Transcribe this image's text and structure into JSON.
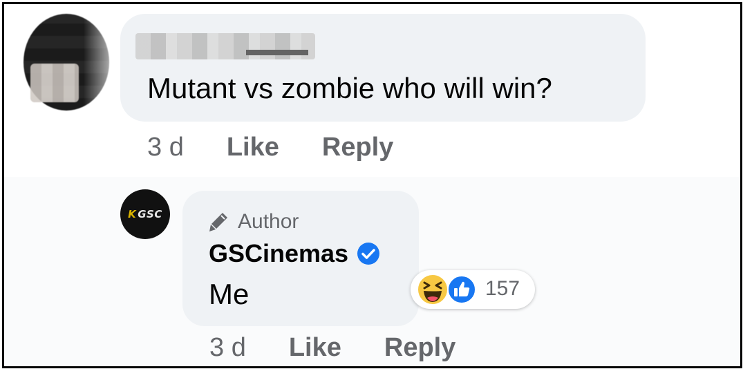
{
  "comment": {
    "author_name_redacted": true,
    "text": "Mutant vs zombie who will win?",
    "time": "3 d",
    "like_label": "Like",
    "reply_label": "Reply"
  },
  "reply": {
    "badge": "Author",
    "author_name": "GSCinemas",
    "avatar_logo_text": "GSC",
    "verified": true,
    "text": "Me",
    "reactions": {
      "types": [
        "haha",
        "like"
      ],
      "count": "157"
    },
    "time": "3 d",
    "like_label": "Like",
    "reply_label": "Reply"
  },
  "colors": {
    "bubble": "#eff2f5",
    "meta_text": "#65676b",
    "verified_blue": "#1877f2",
    "like_blue": "#1877f2",
    "haha_yellow": "#f7c843"
  }
}
